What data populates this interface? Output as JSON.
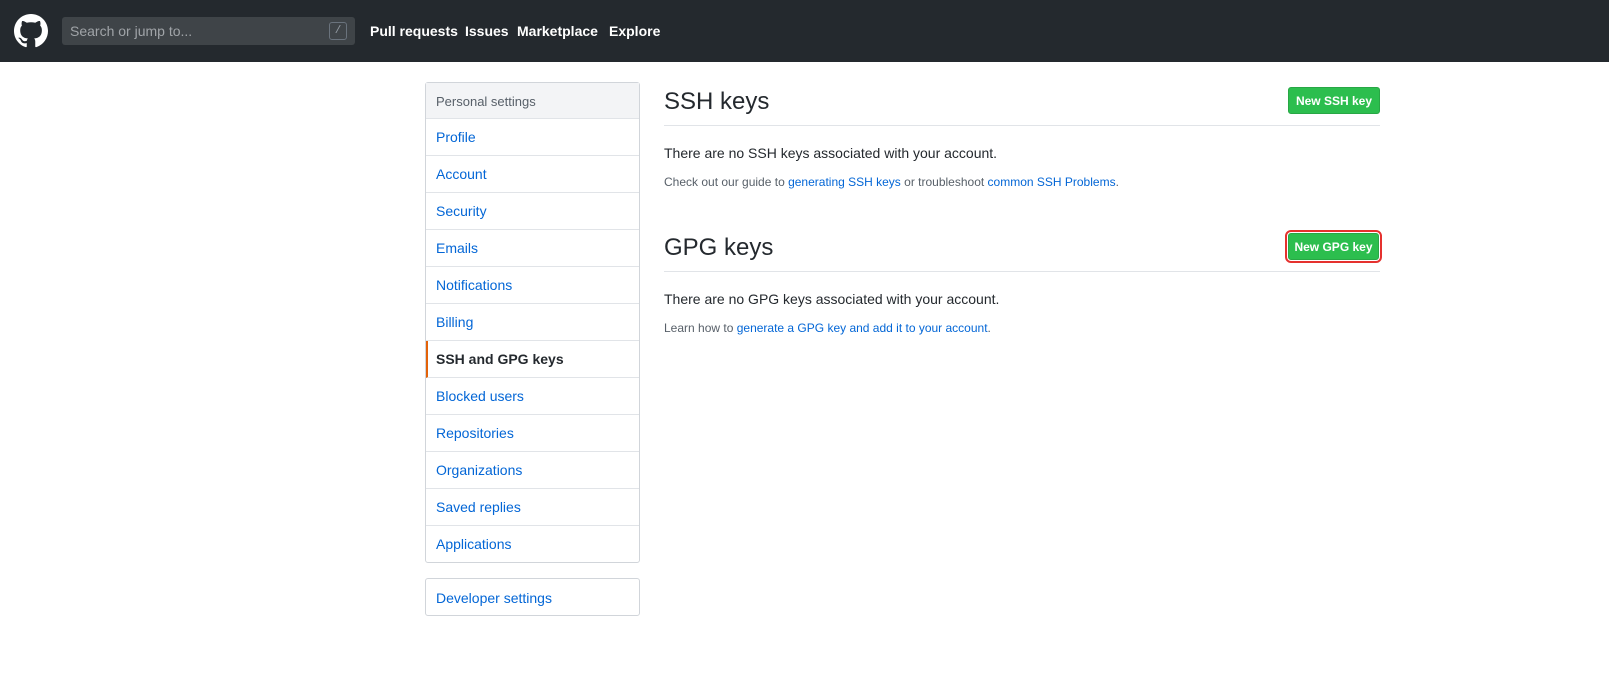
{
  "header": {
    "logo_icon": "github-octocat-icon",
    "search": {
      "placeholder": "Search or jump to...",
      "shortcut": "/"
    },
    "nav": [
      "Pull requests",
      "Issues",
      "Marketplace",
      "Explore"
    ]
  },
  "sidebar": {
    "heading": "Personal settings",
    "items": [
      {
        "label": "Profile",
        "selected": false
      },
      {
        "label": "Account",
        "selected": false
      },
      {
        "label": "Security",
        "selected": false
      },
      {
        "label": "Emails",
        "selected": false
      },
      {
        "label": "Notifications",
        "selected": false
      },
      {
        "label": "Billing",
        "selected": false
      },
      {
        "label": "SSH and GPG keys",
        "selected": true
      },
      {
        "label": "Blocked users",
        "selected": false
      },
      {
        "label": "Repositories",
        "selected": false
      },
      {
        "label": "Organizations",
        "selected": false
      },
      {
        "label": "Saved replies",
        "selected": false
      },
      {
        "label": "Applications",
        "selected": false
      }
    ],
    "developer_settings": "Developer settings"
  },
  "ssh": {
    "title": "SSH keys",
    "button": "New SSH key",
    "blank": "There are no SSH keys associated with your account.",
    "note_prefix": "Check out our guide to ",
    "note_link1": "generating SSH keys",
    "note_middle": " or troubleshoot ",
    "note_link2": "common SSH Problems",
    "note_suffix": "."
  },
  "gpg": {
    "title": "GPG keys",
    "button": "New GPG key",
    "blank": "There are no GPG keys associated with your account.",
    "note_prefix": "Learn how to ",
    "note_link": "generate a GPG key and add it to your account",
    "note_suffix": "."
  },
  "colors": {
    "header_bg": "#24292e",
    "link": "#0366d6",
    "button_green": "#2cbe4e",
    "selected_accent": "#e36209",
    "highlight_outline": "#e5312e"
  }
}
